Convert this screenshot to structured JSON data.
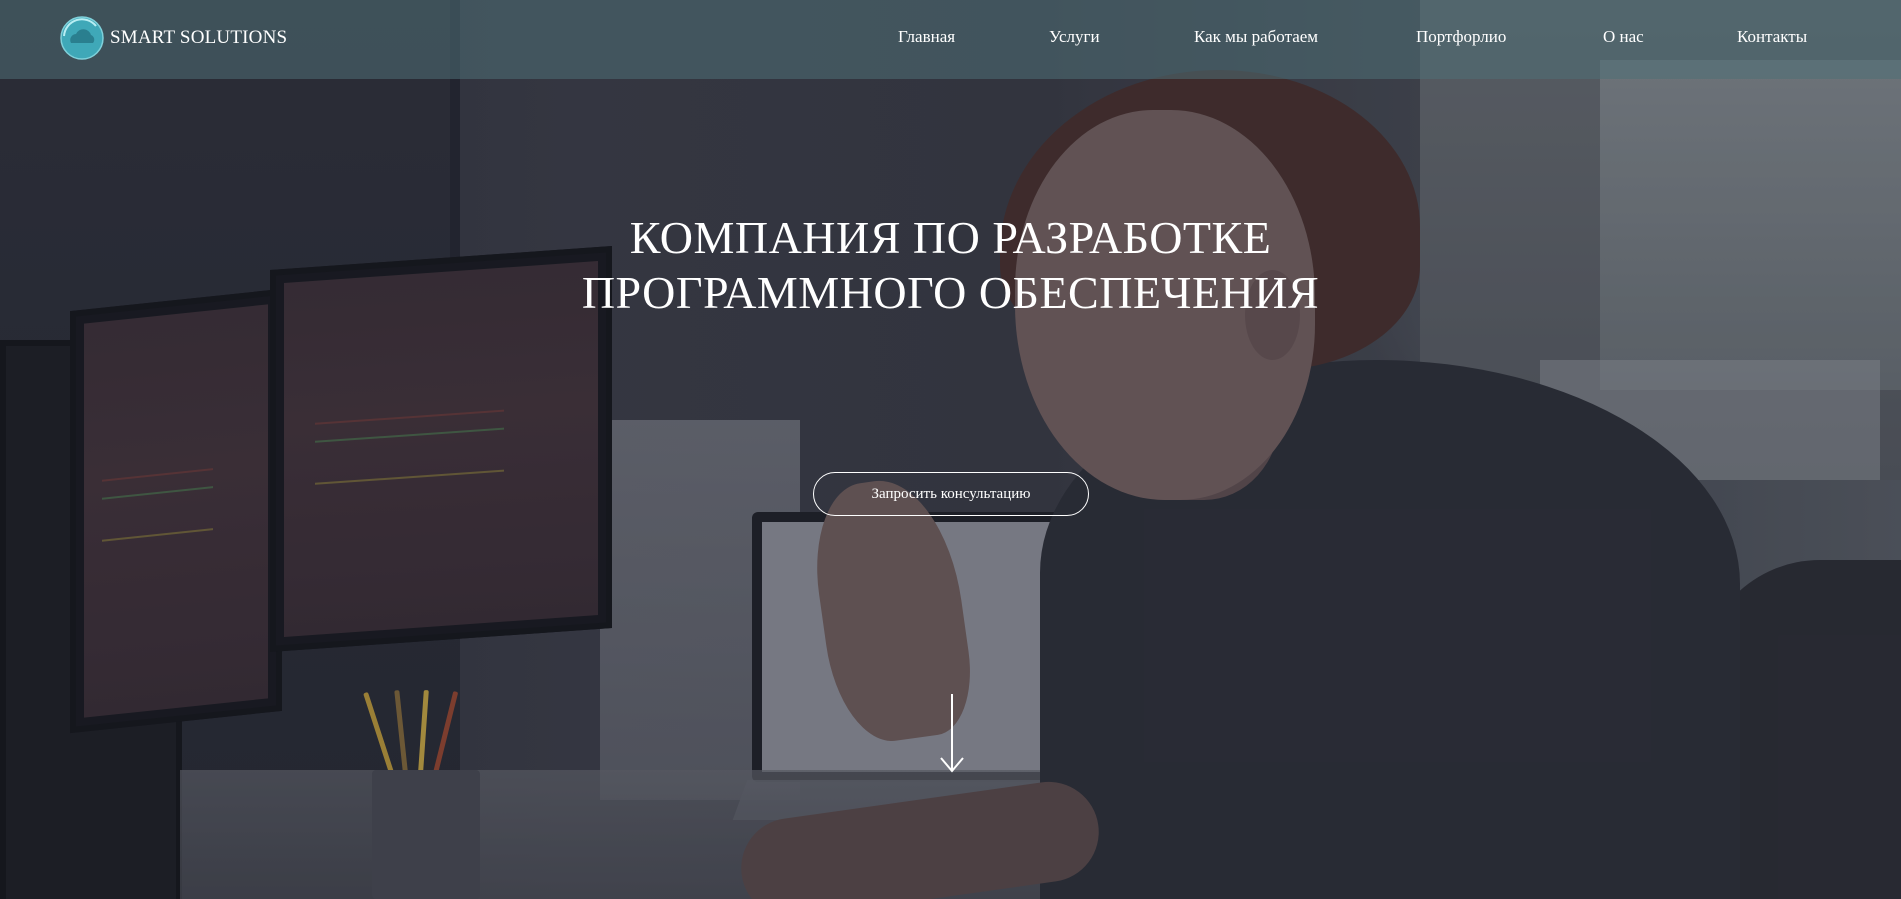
{
  "brand": {
    "name": "SMART SOLUTIONS",
    "accent": "#3fa8b8"
  },
  "nav": {
    "items": [
      {
        "label": "Главная"
      },
      {
        "label": "Услуги"
      },
      {
        "label": "Как мы работаем"
      },
      {
        "label": "Портфорлио"
      },
      {
        "label": "О нас"
      },
      {
        "label": "Контакты"
      }
    ]
  },
  "hero": {
    "title_line1": "КОМПАНИЯ ПО РАЗРАБОТКЕ",
    "title_line2": "ПРОГРАММНОГО ОБЕСПЕЧЕНИЯ",
    "cta_label": "Запросить консультацию",
    "scroll_icon": "arrow-down-icon",
    "background_icon": "office-photo"
  },
  "colors": {
    "header_bg": "#4e7076",
    "text": "#ffffff"
  }
}
